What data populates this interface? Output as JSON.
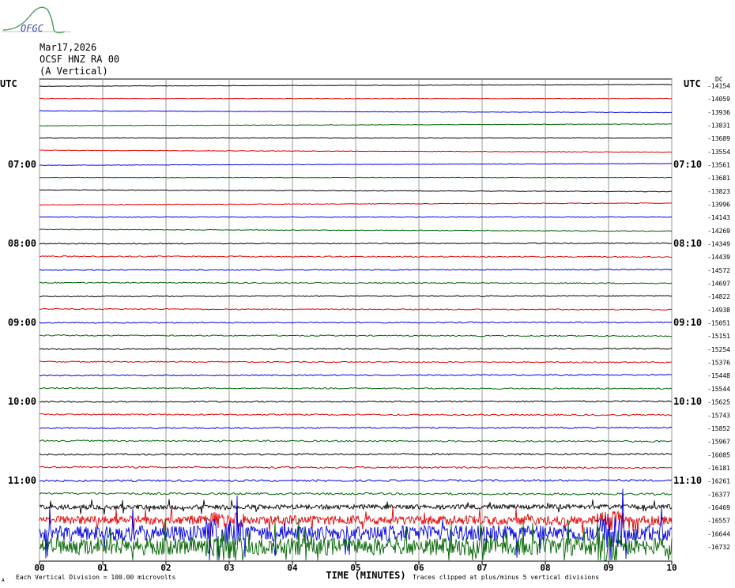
{
  "header": {
    "logo_text": "OFGC",
    "date": "Mar17,2026",
    "station": "OCSF HNZ RA 00",
    "component": "(A Vertical)"
  },
  "chart_data": {
    "type": "line",
    "x_label": "TIME (MINUTES)",
    "x_ticks": [
      "00",
      "01",
      "02",
      "03",
      "04",
      "05",
      "06",
      "07",
      "08",
      "09",
      "10"
    ],
    "x_range": [
      0,
      10
    ],
    "grid": true,
    "left_axis_label": "UTC",
    "right_axis_label": "UTC",
    "left_time_labels": [
      {
        "row": 6,
        "label": "07:00"
      },
      {
        "row": 12,
        "label": "08:00"
      },
      {
        "row": 18,
        "label": "09:00"
      },
      {
        "row": 24,
        "label": "10:00"
      },
      {
        "row": 30,
        "label": "11:00"
      }
    ],
    "right_time_labels": [
      {
        "row": 6,
        "label": "07:10"
      },
      {
        "row": 12,
        "label": "08:10"
      },
      {
        "row": 18,
        "label": "09:10"
      },
      {
        "row": 24,
        "label": "10:10"
      },
      {
        "row": 30,
        "label": "11:10"
      }
    ],
    "dc_label": "DC",
    "trace_colors": [
      "#000000",
      "#e00000",
      "#0000e0",
      "#006400"
    ],
    "trace_dc_offsets": [
      -14154,
      -14059,
      -13936,
      -13831,
      -13689,
      -13554,
      -13561,
      -13681,
      -13823,
      -13996,
      -14143,
      -14269,
      -14349,
      -14439,
      -14572,
      -14697,
      -14822,
      -14938,
      -15051,
      -15151,
      -15254,
      -15376,
      -15448,
      -15544,
      -15625,
      -15743,
      -15852,
      -15967,
      -16085,
      -16181,
      -16261,
      -16377,
      -16469,
      -16557,
      -16644,
      -16732
    ],
    "trace_noise_level": [
      0.15,
      0.15,
      0.15,
      0.15,
      0.15,
      0.15,
      0.15,
      0.15,
      0.2,
      0.2,
      0.2,
      0.2,
      0.3,
      0.35,
      0.3,
      0.3,
      0.3,
      0.3,
      0.35,
      0.35,
      0.35,
      0.35,
      0.35,
      0.35,
      0.4,
      0.4,
      0.4,
      0.45,
      0.45,
      0.5,
      0.55,
      0.6,
      1.3,
      2.6,
      4.5,
      5.0
    ],
    "footer_scale": "Each Vertical Division =  100.00 microvolts",
    "footer_clip": "Traces clipped at plus/minus 5 vertical divisions",
    "footer_mark": "A"
  }
}
